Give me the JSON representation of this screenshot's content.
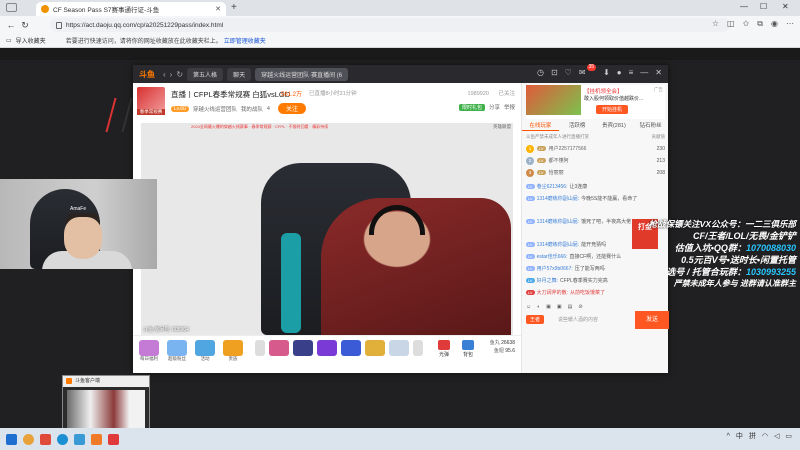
{
  "browser": {
    "tab_title": "CF Season Pass S7赛事通行证-斗鱼",
    "new_tab_symbol": "+",
    "url": "https://act.daoju.qq.com/cp/a20251229pass/index.html",
    "bookmarks": {
      "import_label": "导入收藏夹",
      "hint_text": "若要进行快速访问，请将你的网址收藏放在此收藏夹栏上。",
      "hint_link": "立即管理收藏夹"
    }
  },
  "douyu": {
    "logo": "斗鱼",
    "tabs": [
      "第五人格",
      "聊天",
      "穿越火线运营团队·赛直播间 (6"
    ],
    "notif_badge": "35",
    "room": {
      "title": "直播丨CFPL春季常规赛 白狐vsLGD",
      "hot": "561.2万",
      "live_time": "已直播8小时31分钟",
      "fans_count": "1989920",
      "fans_label": "已关注",
      "avatar_caption": "春季常规赛",
      "level": "Lv.60",
      "channel": "穿越火线运营团队",
      "team_label": "我的战队",
      "team_level": "4",
      "follow_label": "关注 ",
      "share_green": "限时礼包",
      "share_label": "分享",
      "report_label": "举报"
    },
    "video": {
      "ticker": "2024全网最火爆的穿越火线赛事 · 春季常规赛 · CFPL · 不限时回看 · 精彩持续",
      "corner_tag": "英雄联盟",
      "watcher_text": "斗鱼 房间号: 605964"
    },
    "giftbar": {
      "gifts": [
        "每日福利",
        "超级粉丝",
        "活动",
        "贵族",
        "粉丝牌"
      ],
      "light_label": "光弹",
      "bag_label": "背包",
      "fish_ball_label": "鱼丸",
      "fish_ball": "26638",
      "fish_fin_label": "鱼翅",
      "fish_fin": "95.6"
    },
    "chat": {
      "ad_title": "【挂机领全会】",
      "ad_line": "敢入股何领取价值越跌价...",
      "ad_button": "开始挂机",
      "ad_tag": "广告",
      "tabs": [
        "在线玩家",
        "活跃榜",
        "贵宾(281)",
        "钻石粉丝"
      ],
      "rank_header": "斗鱼严禁未成年人进行直播打赏",
      "rank_header_right": "贡献值",
      "ranks": [
        {
          "no": "1",
          "name": "用户2257177566",
          "value": "230"
        },
        {
          "no": "2",
          "name": "都不懂阿",
          "value": "213"
        },
        {
          "no": "3",
          "name": "恰丽丽",
          "value": "208"
        }
      ],
      "messages": [
        {
          "user": "巷尘6213456:",
          "text": "让3连康"
        },
        {
          "user": "1314磨练你副山屁:",
          "text": "今晚5S能不能赢，看命了"
        },
        {
          "user": "1314磨练你副山屁:",
          "text": "饿死了吧，半夜高大佬"
        },
        {
          "user": "1314磨练你副山屁:",
          "text": "能开竞猜吗"
        },
        {
          "user": "estar佳乐666:",
          "text": "直接CF啊，还能赛什么"
        },
        {
          "user": "用户57x9b0667:",
          "text": "压了能写两吗"
        },
        {
          "user": "好月之舞:",
          "text": "CFPL春季赛实力完高"
        },
        {
          "user": "大刀阔斧的散:",
          "text": "从前吃饭饿菜了"
        }
      ],
      "noble_label": "王者",
      "input_placeholder": "说些暖人酒的内容",
      "send_label": "发送"
    }
  },
  "overlay": {
    "promo_lines": [
      "枪战保镖关注VX公众号：一二三俱乐部",
      "CF/王者/LOL/无畏/金铲铲",
      "估值入坑•QQ群：",
      "1070088030",
      "0.5元百V号•送时长•闲置托管",
      "选号 / 托管合玩群：",
      "1030993255",
      "严禁未成年人参与 进群请认准群主"
    ],
    "dakin_label": "打金",
    "cam_logo": "AmaFe",
    "thumb_caption": "斗鱼客户端"
  },
  "taskbar": {
    "ime": "中",
    "tray_symbols": [
      "^",
      "拼"
    ]
  }
}
